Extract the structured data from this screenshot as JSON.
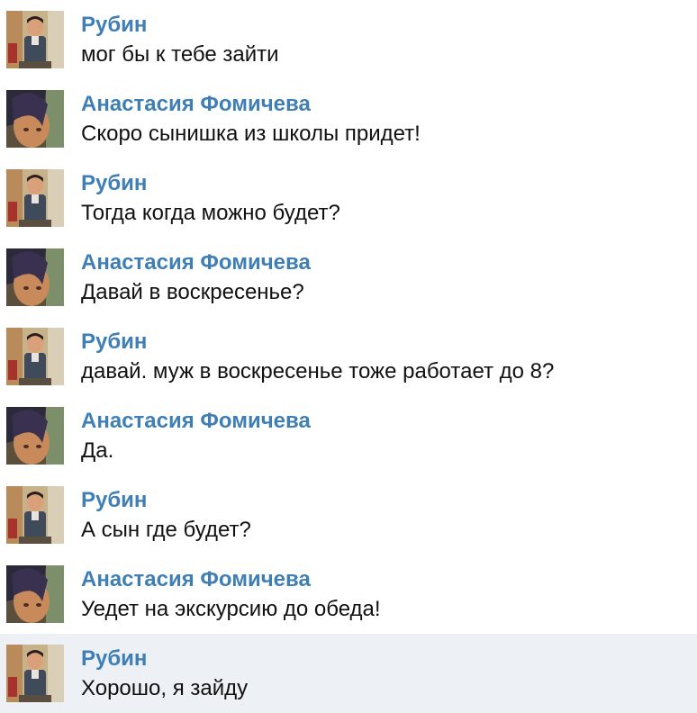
{
  "messages": [
    {
      "author": "Рубин",
      "text": "мог бы к тебе зайти",
      "avatar": "man-avatar"
    },
    {
      "author": "Анастасия Фомичева",
      "text": "Скоро сынишка из школы придет!",
      "avatar": "woman-avatar"
    },
    {
      "author": "Рубин",
      "text": "Тогда когда можно будет?",
      "avatar": "man-avatar"
    },
    {
      "author": "Анастасия Фомичева",
      "text": "Давай в воскресенье?",
      "avatar": "woman-avatar"
    },
    {
      "author": "Рубин",
      "text": "давай. муж в воскресенье тоже работает до 8?",
      "avatar": "man-avatar"
    },
    {
      "author": "Анастасия Фомичева",
      "text": "Да.",
      "avatar": "woman-avatar"
    },
    {
      "author": "Рубин",
      "text": "А сын где будет?",
      "avatar": "man-avatar"
    },
    {
      "author": "Анастасия Фомичева",
      "text": "Уедет на экскурсию до обеда!",
      "avatar": "woman-avatar"
    },
    {
      "author": "Рубин",
      "text": "Хорошо, я зайду",
      "avatar": "man-avatar",
      "highlighted": true
    }
  ],
  "colors": {
    "author": "#3f7fb5",
    "text": "#111111",
    "highlight_bg": "#edf1f5"
  }
}
